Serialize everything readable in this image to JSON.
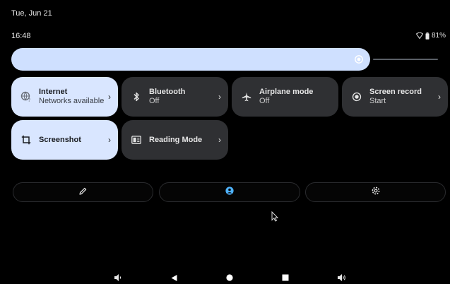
{
  "status_bar": {
    "date": "Tue, Jun 21",
    "time": "16:48",
    "battery": "81%",
    "icons": [
      "wifi-icon",
      "battery-icon"
    ]
  },
  "brightness": {
    "level": 0.92
  },
  "tiles": [
    {
      "title": "Internet",
      "subtitle": "Networks available",
      "icon": "internet-icon",
      "state": "on",
      "has_chevron": true
    },
    {
      "title": "Bluetooth",
      "subtitle": "Off",
      "icon": "bluetooth-icon",
      "state": "off",
      "has_chevron": true
    },
    {
      "title": "Airplane mode",
      "subtitle": "Off",
      "icon": "airplane-icon",
      "state": "off",
      "has_chevron": false
    },
    {
      "title": "Screen record",
      "subtitle": "Start",
      "icon": "screen-record-icon",
      "state": "off",
      "has_chevron": true
    },
    {
      "title": "Screenshot",
      "subtitle": "",
      "icon": "screenshot-icon",
      "state": "on",
      "has_chevron": true
    },
    {
      "title": "Reading Mode",
      "subtitle": "",
      "icon": "reading-mode-icon",
      "state": "off",
      "has_chevron": true
    }
  ],
  "chevron": "›",
  "bottom_buttons": [
    "edit-icon",
    "user-icon",
    "settings-icon"
  ],
  "nav_bar": [
    "volume-down-icon",
    "back-icon",
    "home-icon",
    "recents-icon",
    "volume-up-icon"
  ],
  "colors": {
    "tile_on": "#d9e6ff",
    "tile_off": "#2f3033",
    "accent": "#4fb3ff"
  }
}
